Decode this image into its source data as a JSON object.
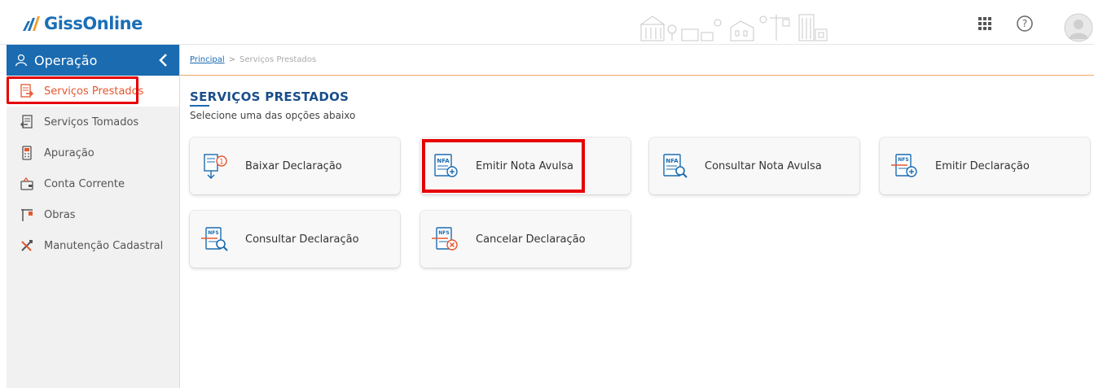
{
  "brand": {
    "name": "GissOnline",
    "color": "#1b6fb6"
  },
  "header": {
    "icons": [
      "apps-grid-icon",
      "help-icon",
      "user-avatar-icon"
    ]
  },
  "sidebar": {
    "section_title": "Operação",
    "items": [
      {
        "label": "Serviços Prestados",
        "icon": "invoice-out-icon",
        "active": true
      },
      {
        "label": "Serviços Tomados",
        "icon": "invoice-in-icon",
        "active": false
      },
      {
        "label": "Apuração",
        "icon": "calculator-icon",
        "active": false
      },
      {
        "label": "Conta Corrente",
        "icon": "wallet-icon",
        "active": false
      },
      {
        "label": "Obras",
        "icon": "crane-icon",
        "active": false
      },
      {
        "label": "Manutenção Cadastral",
        "icon": "tools-icon",
        "active": false
      }
    ]
  },
  "breadcrumb": {
    "home": "Principal",
    "separator": ">",
    "current": "Serviços Prestados"
  },
  "main": {
    "title": "SERVIÇOS PRESTADOS",
    "subtitle": "Selecione uma das opções abaixo",
    "cards": [
      {
        "label": "Baixar Declaração",
        "icon": "download-declaration-icon"
      },
      {
        "label": "Emitir Nota Avulsa",
        "icon": "nfa-add-icon",
        "highlighted": true
      },
      {
        "label": "Consultar Nota Avulsa",
        "icon": "nfa-search-icon"
      },
      {
        "label": "Emitir Declaração",
        "icon": "nfs-add-icon"
      },
      {
        "label": "Consultar Declaração",
        "icon": "nfs-search-icon"
      },
      {
        "label": "Cancelar Declaração",
        "icon": "nfs-cancel-icon"
      }
    ]
  },
  "colors": {
    "accent": "#1a6bb0",
    "active_text": "#e5572f",
    "highlight_border": "#e60000"
  }
}
